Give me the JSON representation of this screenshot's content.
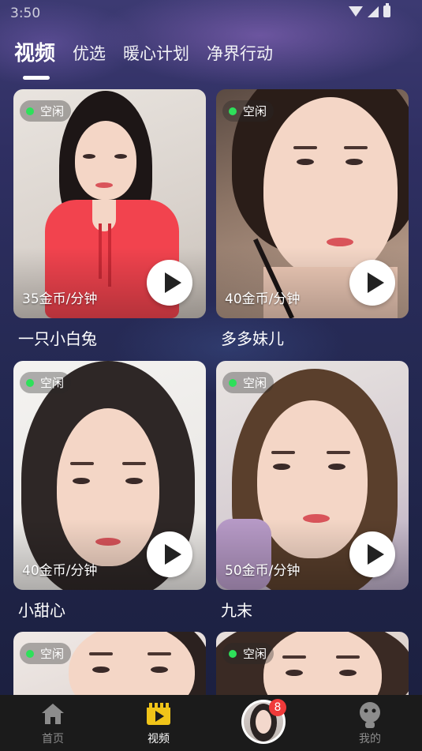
{
  "status_bar": {
    "time": "3:50"
  },
  "tabs": [
    {
      "label": "视频",
      "active": true
    },
    {
      "label": "优选",
      "active": false
    },
    {
      "label": "暖心计划",
      "active": false
    },
    {
      "label": "净界行动",
      "active": false
    }
  ],
  "cards": [
    {
      "status": "空闲",
      "price": "35金币/分钟",
      "name": "一只小白兔"
    },
    {
      "status": "空闲",
      "price": "40金币/分钟",
      "name": "多多妹儿"
    },
    {
      "status": "空闲",
      "price": "40金币/分钟",
      "name": "小甜心"
    },
    {
      "status": "空闲",
      "price": "50金币/分钟",
      "name": "九末"
    },
    {
      "status": "空闲"
    },
    {
      "status": "空闲"
    }
  ],
  "bottom_nav": {
    "items": [
      {
        "label": "首页",
        "icon": "home-icon"
      },
      {
        "label": "视频",
        "icon": "video-icon",
        "active": true
      },
      {
        "label": "",
        "icon": "avatar"
      },
      {
        "label": "我的",
        "icon": "profile-icon"
      }
    ],
    "badge_count": "8"
  },
  "colors": {
    "online_dot": "#2ee05a",
    "nav_background": "#1b1b1b",
    "active_video_icon": "#f0c419",
    "badge": "#f03a3a"
  }
}
